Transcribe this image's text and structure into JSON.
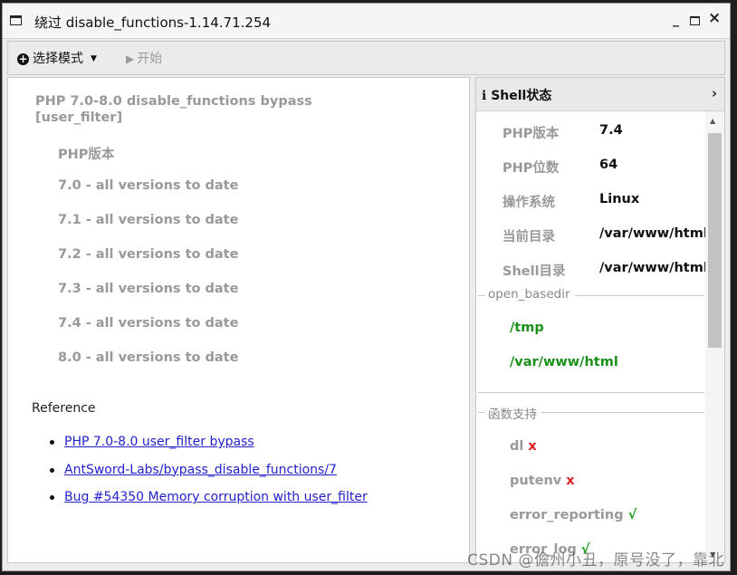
{
  "window": {
    "title": "绕过 disable_functions-1.14.71.254"
  },
  "toolbar": {
    "mode_label": "选择模式",
    "start_label": "开始"
  },
  "main": {
    "heading": "PHP 7.0-8.0 disable_functions bypass [user_filter]",
    "version_header": "PHP版本",
    "versions": [
      "7.0 - all versions to date",
      "7.1 - all versions to date",
      "7.2 - all versions to date",
      "7.3 - all versions to date",
      "7.4 - all versions to date",
      "8.0 - all versions to date"
    ],
    "reference_title": "Reference",
    "references": [
      "PHP 7.0-8.0 user_filter bypass",
      "AntSword-Labs/bypass_disable_functions/7",
      "Bug #54350 Memory corruption with user_filter"
    ]
  },
  "shell_panel": {
    "title": "Shell状态",
    "info": [
      {
        "key": "PHP版本",
        "value": "7.4"
      },
      {
        "key": "PHP位数",
        "value": "64"
      },
      {
        "key": "操作系统",
        "value": "Linux"
      },
      {
        "key": "当前目录",
        "value": "/var/www/html"
      },
      {
        "key": "Shell目录",
        "value": "/var/www/html"
      }
    ],
    "open_basedir": {
      "legend": "open_basedir",
      "paths": [
        "/tmp",
        "/var/www/html"
      ]
    },
    "functions": {
      "legend": "函数支持",
      "items": [
        {
          "name": "dl",
          "mark": "x"
        },
        {
          "name": "putenv",
          "mark": "x"
        },
        {
          "name": "error_reporting",
          "mark": "√"
        },
        {
          "name": "error_log",
          "mark": "√"
        }
      ]
    }
  },
  "watermark": "CSDN @儋州小丑，原号没了，靠北",
  "colors": {
    "ok": "#1a9a1a",
    "fail": "#e02020",
    "link": "#2222cc"
  }
}
